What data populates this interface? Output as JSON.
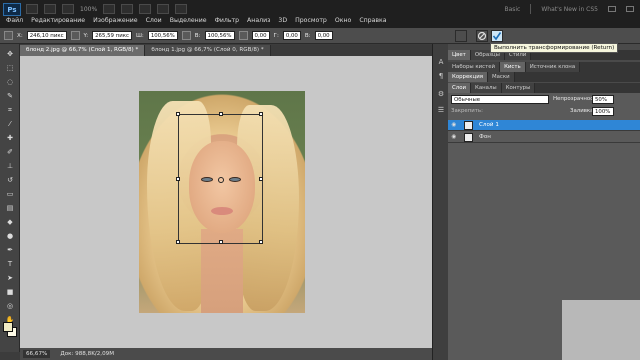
{
  "app": {
    "logo": "Ps",
    "zoom": "100%"
  },
  "menu": [
    "Файл",
    "Редактирование",
    "Изображение",
    "Слои",
    "Выделение",
    "Фильтр",
    "Анализ",
    "3D",
    "Просмотр",
    "Окно",
    "Справка"
  ],
  "workspace": {
    "basic": "Basic",
    "whats_new": "What's New in CS5"
  },
  "options": {
    "x_label": "X:",
    "x_value": "246,10 пикс",
    "y_label": "Y:",
    "y_value": "265,59 пикс",
    "w_label": "Ш:",
    "w_value": "100,56%",
    "h_label": "В:",
    "h_value": "100,56%",
    "angle_value": "0,00",
    "h_skew_label": "Г:",
    "h_skew_value": "0,00",
    "v_skew_label": "В:",
    "v_skew_value": "0,00"
  },
  "tooltip": "Выполнить трансформирование (Return)",
  "doc_tabs": [
    "блонд 2.jpg @ 66,7% (Слой 1, RGB/8) *",
    "блонд 1.jpg @ 66,7% (Слой 0, RGB/8) *"
  ],
  "status": {
    "zoom": "66,67%",
    "doc": "Док: 988,8K/2,09M"
  },
  "panels": {
    "tabs_row1": [
      "Цвет",
      "Образцы",
      "Стили"
    ],
    "tabs_row2": [
      "Наборы кистей",
      "Кисть",
      "Источник клона"
    ],
    "tabs_row3": [
      "Коррекция",
      "Маски"
    ],
    "tabs_row4": [
      "Слои",
      "Каналы",
      "Контуры"
    ],
    "blend_mode": "Обычные",
    "opacity_label": "Непрозрачность:",
    "opacity_value": "50%",
    "lock_label": "Закрепить:",
    "fill_label": "Заливка:",
    "fill_value": "100%",
    "layers": [
      {
        "name": "Слой 1",
        "selected": true
      },
      {
        "name": "Фон",
        "selected": false
      }
    ]
  },
  "colors": {
    "accent": "#2f86d6",
    "commit": "#3aa0e8"
  }
}
